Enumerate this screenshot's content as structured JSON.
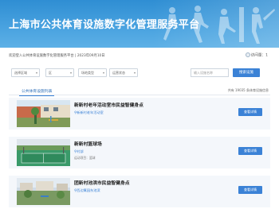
{
  "banner": {
    "title": "上海市公共体育设施数字化管理服务平台"
  },
  "infobar": {
    "welcome": "欢迎登入公共体育设施数字化管理服务平台 | 2023年09月10日",
    "visit_label": "访问量",
    "visit_count": "1"
  },
  "filters": {
    "district": "选择区域",
    "street": "区",
    "type": "场地类型",
    "status": "运营状态",
    "search_placeholder": "输入设施名称",
    "search_button": "搜索设施"
  },
  "list": {
    "title": "公共体育设施列表",
    "count_text": "共有 19035 条体育设施信息",
    "items": [
      {
        "name": "新新村老年活动室市民益智健身点",
        "address": "新新村老年活动室",
        "extra": "",
        "button": "查看详情"
      },
      {
        "name": "新新村篮球场",
        "address": "村部",
        "extra": "运动项目：篮球",
        "button": "查看详情"
      },
      {
        "name": "团新村池滨市民益智健身点",
        "address": "西边篱园东池滨",
        "extra": "",
        "button": "查看详情"
      }
    ]
  },
  "colors": {
    "primary": "#3b82d6",
    "banner_top": "#2f8ed3",
    "card_bg": "#f4f7fb"
  }
}
